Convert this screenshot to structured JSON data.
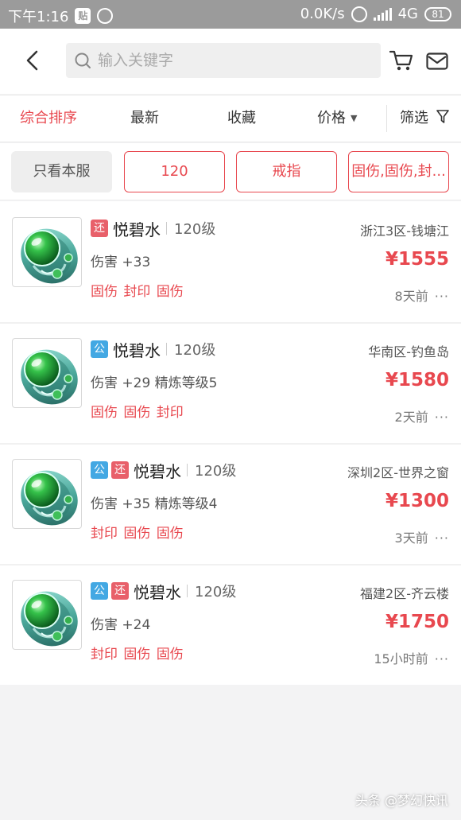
{
  "status_bar": {
    "time": "下午1:16",
    "badge": "贴",
    "network_speed": "0.0K/s",
    "network_type": "4G",
    "battery": "81"
  },
  "header": {
    "search_placeholder": "输入关键字",
    "icons": [
      "back-arrow-icon",
      "search-icon",
      "cart-icon",
      "mail-icon"
    ]
  },
  "sort_bar": {
    "tabs": [
      "综合排序",
      "最新",
      "收藏",
      "价格",
      "筛选"
    ],
    "active": "综合排序"
  },
  "filters": {
    "local_only": "只看本服",
    "chips": [
      "120",
      "戒指",
      "固伤,固伤,封..."
    ]
  },
  "listings": [
    {
      "badges": [
        "还"
      ],
      "name": "悦碧水",
      "level": "120级",
      "server": "浙江3区-钱塘江",
      "stats": "伤害 +33",
      "price": "¥1555",
      "tags": "固伤 封印 固伤",
      "time": "8天前",
      "more": "···"
    },
    {
      "badges": [
        "公"
      ],
      "name": "悦碧水",
      "level": "120级",
      "server": "华南区-钓鱼岛",
      "stats": "伤害 +29 精炼等级5",
      "price": "¥1580",
      "tags": "固伤 固伤 封印",
      "time": "2天前",
      "more": "···"
    },
    {
      "badges": [
        "公",
        "还"
      ],
      "name": "悦碧水",
      "level": "120级",
      "server": "深圳2区-世界之窗",
      "stats": "伤害 +35 精炼等级4",
      "price": "¥1300",
      "tags": "封印 固伤 固伤",
      "time": "3天前",
      "more": "···"
    },
    {
      "badges": [
        "公",
        "还"
      ],
      "name": "悦碧水",
      "level": "120级",
      "server": "福建2区-齐云楼",
      "stats": "伤害 +24",
      "price": "¥1750",
      "tags": "封印 固伤 固伤",
      "time": "15小时前",
      "more": "···"
    }
  ],
  "watermark": "头条 @梦幻快讯",
  "colors": {
    "accent": "#e8484f",
    "gong_badge": "#43a8e3",
    "huan_badge": "#e8606a",
    "status_bar": "#9b9b9b"
  }
}
